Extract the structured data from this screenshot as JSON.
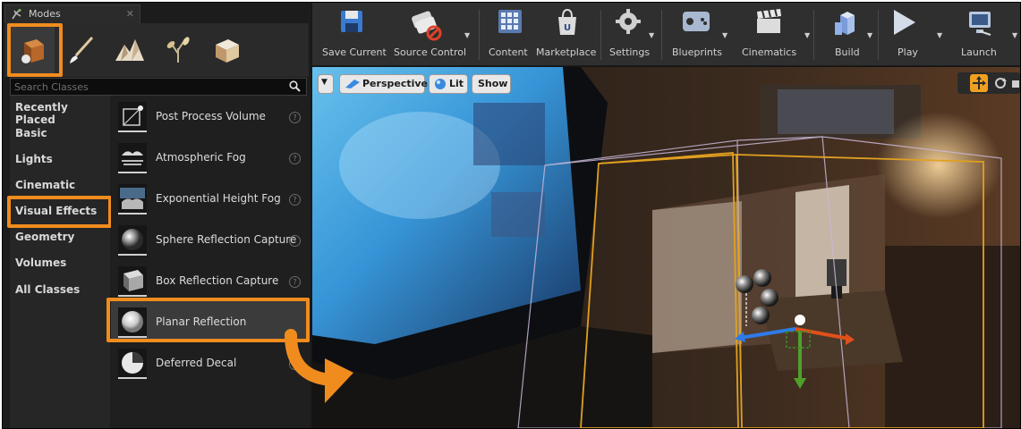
{
  "modes_panel": {
    "tab_label": "Modes",
    "search_placeholder": "Search Classes",
    "categories": [
      "Recently Placed",
      "Basic",
      "Lights",
      "Cinematic",
      "Visual Effects",
      "Geometry",
      "Volumes",
      "All Classes"
    ],
    "items": [
      {
        "label": "Post Process Volume",
        "icon": "post-process-volume-icon"
      },
      {
        "label": "Atmospheric Fog",
        "icon": "atmospheric-fog-icon"
      },
      {
        "label": "Exponential Height Fog",
        "icon": "exponential-height-fog-icon"
      },
      {
        "label": "Sphere Reflection Capture",
        "icon": "sphere-reflection-capture-icon"
      },
      {
        "label": "Box Reflection Capture",
        "icon": "box-reflection-capture-icon"
      },
      {
        "label": "Planar Reflection",
        "icon": "planar-reflection-icon"
      },
      {
        "label": "Deferred Decal",
        "icon": "deferred-decal-icon"
      }
    ],
    "mode_icons": [
      "place-mode-icon",
      "paint-mode-icon",
      "landscape-mode-icon",
      "foliage-mode-icon",
      "geometry-mode-icon"
    ]
  },
  "toolbar": {
    "save_current": "Save Current",
    "source_control": "Source Control",
    "content": "Content",
    "marketplace": "Marketplace",
    "settings": "Settings",
    "blueprints": "Blueprints",
    "cinematics": "Cinematics",
    "build": "Build",
    "play": "Play",
    "launch": "Launch"
  },
  "viewport": {
    "perspective": "Perspective",
    "lit": "Lit",
    "show": "Show"
  },
  "colors": {
    "highlight": "#f08c1e",
    "panel_bg": "#1c1c1c",
    "toolbar_bg": "#2f2f2f",
    "volume_outline_orange": "#e0a020",
    "volume_outline_white": "#c9b8d8"
  }
}
